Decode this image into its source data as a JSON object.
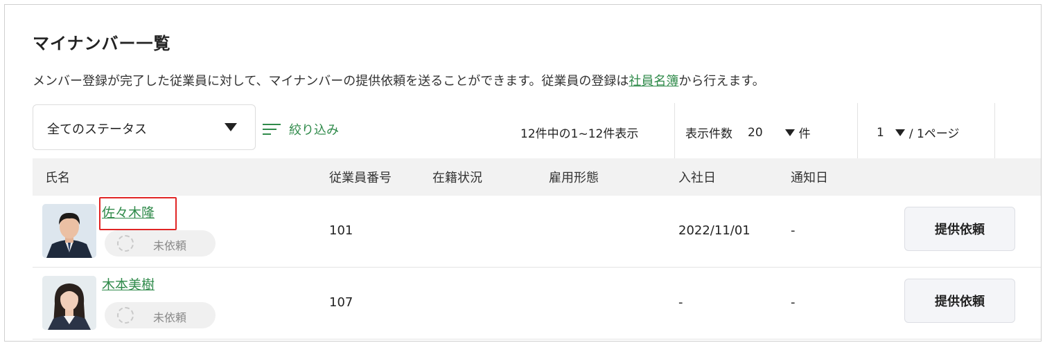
{
  "page": {
    "title": "マイナンバー一覧",
    "description_prefix": "メンバー登録が完了した従業員に対して、マイナンバーの提供依頼を送ることができます。従業員の登録は",
    "description_link": "社員名簿",
    "description_suffix": "から行えます。"
  },
  "toolbar": {
    "status_filter": {
      "selected": "全てのステータス"
    },
    "filter_button": "絞り込み",
    "count_text": "12件中の1~12件表示",
    "per_page_label": "表示件数",
    "per_page_value": "20",
    "per_page_unit": "件",
    "page_current": "1",
    "page_total_text": "/ 1ページ"
  },
  "table": {
    "columns": {
      "name": "氏名",
      "employee_no": "従業員番号",
      "enrollment": "在籍状況",
      "employment_type": "雇用形態",
      "join_date": "入社日",
      "notice_date": "通知日"
    },
    "rows": [
      {
        "name": "佐々木隆",
        "status": "未依頼",
        "employee_no": "101",
        "enrollment": "",
        "employment_type": "",
        "join_date": "2022/11/01",
        "notice_date": "-",
        "action": "提供依頼",
        "avatar": "male-portrait"
      },
      {
        "name": "木本美樹",
        "status": "未依頼",
        "employee_no": "107",
        "enrollment": "",
        "employment_type": "",
        "join_date": "-",
        "notice_date": "-",
        "action": "提供依頼",
        "avatar": "female-portrait"
      }
    ]
  },
  "colors": {
    "link": "#2f8a4a",
    "highlight": "#e02424",
    "header_bg": "#f2f2f2"
  }
}
